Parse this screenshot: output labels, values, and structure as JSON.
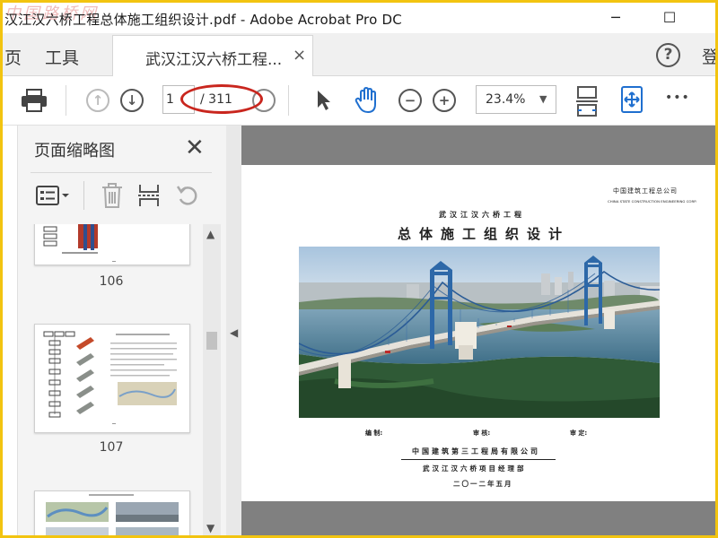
{
  "window": {
    "title": "汉江汉六桥工程总体施工组织设计.pdf - Adobe Acrobat Pro DC",
    "watermark": "中国路桥网",
    "minimize_glyph": "─",
    "maximize_glyph": "☐"
  },
  "menu": {
    "home_label": "页",
    "tools_label": "工具",
    "doc_tab_label": "武汉江汉六桥工程...",
    "doc_tab_close": "×",
    "help_glyph": "?",
    "login_label": "登"
  },
  "toolbar": {
    "page_current": "1",
    "page_total": "/ 311",
    "zoom": "23.4%",
    "zoom_arrow": "▼",
    "prev_glyph": "↑",
    "next_glyph": "↓",
    "zoom_out_glyph": "−",
    "zoom_in_glyph": "+",
    "more_glyph": "•••"
  },
  "thumbnail_panel": {
    "title": "页面缩略图",
    "close_glyph": "✕",
    "pages": [
      {
        "label": "106"
      },
      {
        "label": "107"
      }
    ],
    "scroll_up": "▲",
    "scroll_down": "▼"
  },
  "collapse_arrow": "◀",
  "document": {
    "company_top": "中国建筑工程总公司",
    "company_top_en": "CHINA STATE CONSTRUCTION ENGINEERING CORP.",
    "project": "武汉江汉六桥工程",
    "doc_title": "总体施工组织设计",
    "sign_compile": "编    制:",
    "sign_review": "审    核:",
    "sign_approve": "审    定:",
    "org_1": "中国建筑第三工程局有限公司",
    "org_2": "武汉江汉六桥项目经理部",
    "date": "二〇一二年五月"
  },
  "colors": {
    "accent_blue": "#2a6fd0",
    "annotation_red": "#c9261e",
    "frame_yellow": "#f2c410"
  },
  "icons": [
    "print-icon",
    "page-up-icon",
    "page-down-icon",
    "select-cursor-icon",
    "hand-tool-icon",
    "zoom-out-icon",
    "zoom-in-icon",
    "fit-page-icon",
    "full-screen-icon",
    "more-icon",
    "page-options-icon",
    "trash-icon",
    "insert-page-icon",
    "rotate-icon",
    "help-icon"
  ]
}
